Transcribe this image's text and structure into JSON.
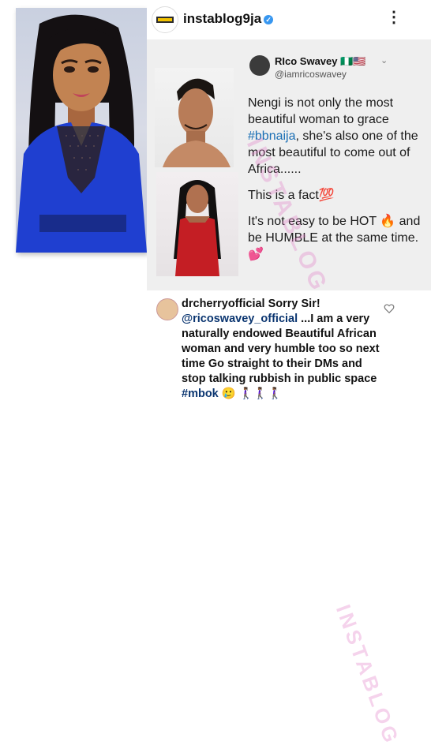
{
  "post": {
    "username": "instablog9ja",
    "more_glyph": "⋮",
    "verified_glyph": "✓"
  },
  "tweet": {
    "name": "RIco Swavey 🇳🇬🇺🇸",
    "handle": "@iamricoswavey",
    "more": "⌄",
    "p1_a": "Nengi is not only the most beautiful woman to grace ",
    "p1_tag": "#bbnaija",
    "p1_b": ",  she's also one of the most beautiful to come out of Africa......",
    "p2": "This is a fact💯",
    "p3": "It's not easy to be HOT 🔥 and be HUMBLE  at the same time.💕"
  },
  "comment": {
    "user": "drcherryofficial",
    "lead": " Sorry Sir! ",
    "mention": "@ricoswavey_official",
    "body": " ...I am a very naturally endowed Beautiful African woman and very humble too so next time Go straight to their DMs and stop talking rubbish in public space ",
    "tag": "#mbok",
    "emoji": " 🥲 🚶🏾‍♀️🚶🏾‍♀️🚶🏾‍♀️"
  },
  "watermark": "INSTABLOG",
  "watermark2": "INSTABLOG",
  "icons": [
    "verified-icon",
    "more-options-icon",
    "heart-icon",
    "chevron-down-icon"
  ],
  "colors": {
    "verified": "#3897f0",
    "hashtag": "#1b6fb5",
    "dress_blue": "#1f3fd0"
  }
}
